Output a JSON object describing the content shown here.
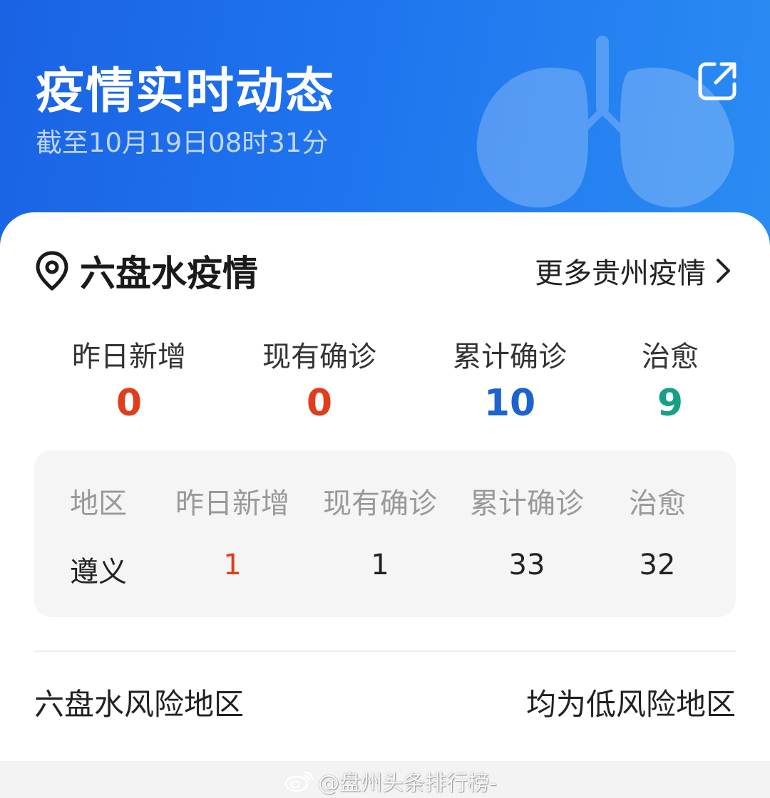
{
  "header": {
    "title": "疫情实时动态",
    "subtitle": "截至10月19日08时31分",
    "share_icon": "share-external-icon"
  },
  "city": {
    "title": "六盘水疫情",
    "location_icon": "location-pin-icon",
    "more_label": "更多贵州疫情",
    "more_icon": "chevron-right-icon"
  },
  "stats": [
    {
      "label": "昨日新增",
      "value": "0",
      "color": "#e23c1b"
    },
    {
      "label": "现有确诊",
      "value": "0",
      "color": "#e23c1b"
    },
    {
      "label": "累计确诊",
      "value": "10",
      "color": "#1d63cf"
    },
    {
      "label": "治愈",
      "value": "9",
      "color": "#16a085"
    }
  ],
  "table": {
    "headers": [
      "地区",
      "昨日新增",
      "现有确诊",
      "累计确诊",
      "治愈"
    ],
    "rows": [
      {
        "region": "遵义",
        "new": "1",
        "current": "1",
        "total": "33",
        "cured": "32"
      }
    ]
  },
  "risk": {
    "label": "六盘水风险地区",
    "value": "均为低风险地区"
  },
  "watermark": {
    "text": "@盘州头条排行榜-",
    "icon": "weibo-logo-icon"
  },
  "colors": {
    "header_blue": "#1f6fe8",
    "increase_red": "#e23c1b",
    "total_blue": "#1d63cf",
    "cured_green": "#16a085"
  }
}
